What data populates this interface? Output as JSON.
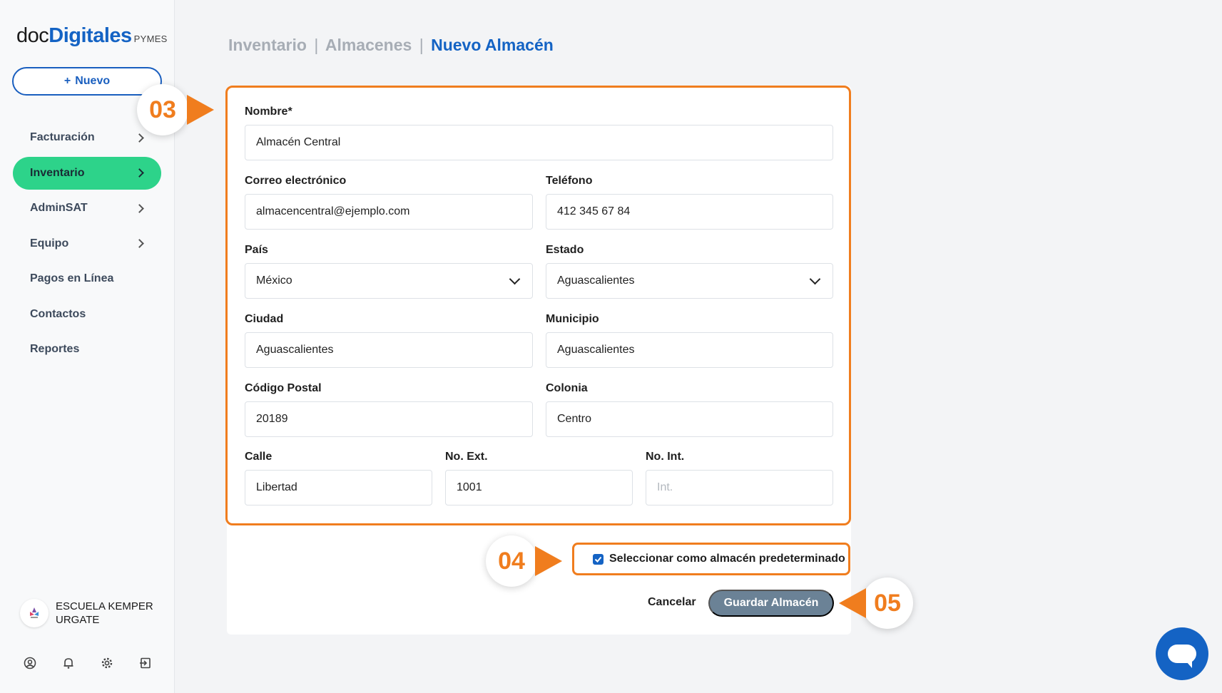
{
  "logo": {
    "part1": "doc",
    "part2": "Digitales",
    "part3": "PYMES"
  },
  "sidebar": {
    "new_label": "Nuevo",
    "items": [
      {
        "label": "Facturación",
        "has_submenu": true,
        "active": false
      },
      {
        "label": "Inventario",
        "has_submenu": true,
        "active": true
      },
      {
        "label": "AdminSAT",
        "has_submenu": true,
        "active": false
      },
      {
        "label": "Equipo",
        "has_submenu": true,
        "active": false
      },
      {
        "label": "Pagos en Línea",
        "has_submenu": false,
        "active": false
      },
      {
        "label": "Contactos",
        "has_submenu": false,
        "active": false
      },
      {
        "label": "Reportes",
        "has_submenu": false,
        "active": false
      }
    ],
    "account": {
      "line1": "ESCUELA KEMPER",
      "line2": "URGATE"
    },
    "bottom_icons": [
      "user-icon",
      "bell-icon",
      "gear-icon",
      "logout-icon"
    ]
  },
  "breadcrumb": {
    "part1": "Inventario",
    "part2": "Almacenes",
    "current": "Nuevo Almacén",
    "separator": "|"
  },
  "form": {
    "nombre": {
      "label": "Nombre*",
      "value": "Almacén Central"
    },
    "correo": {
      "label": "Correo electrónico",
      "value": "almacencentral@ejemplo.com"
    },
    "telefono": {
      "label": "Teléfono",
      "value": "412 345 67 84"
    },
    "pais": {
      "label": "País",
      "value": "México"
    },
    "estado": {
      "label": "Estado",
      "value": "Aguascalientes"
    },
    "ciudad": {
      "label": "Ciudad",
      "value": "Aguascalientes"
    },
    "municipio": {
      "label": "Municipio",
      "value": "Aguascalientes"
    },
    "cp": {
      "label": "Código Postal",
      "value": "20189"
    },
    "colonia": {
      "label": "Colonia",
      "value": "Centro"
    },
    "calle": {
      "label": "Calle",
      "value": "Libertad"
    },
    "noext": {
      "label": "No. Ext.",
      "value": "1001"
    },
    "noint": {
      "label": "No. Int.",
      "placeholder": "Int."
    }
  },
  "default_checkbox": {
    "label": "Seleccionar como almacén predeterminado",
    "checked": true
  },
  "actions": {
    "cancel": "Cancelar",
    "save": "Guardar Almacén"
  },
  "steps": {
    "s3": "03",
    "s4": "04",
    "s5": "05"
  },
  "colors": {
    "accent_orange": "#f07d1e",
    "brand_blue": "#1463c4",
    "active_green": "#2dd38a",
    "save_button": "#6b8296"
  }
}
